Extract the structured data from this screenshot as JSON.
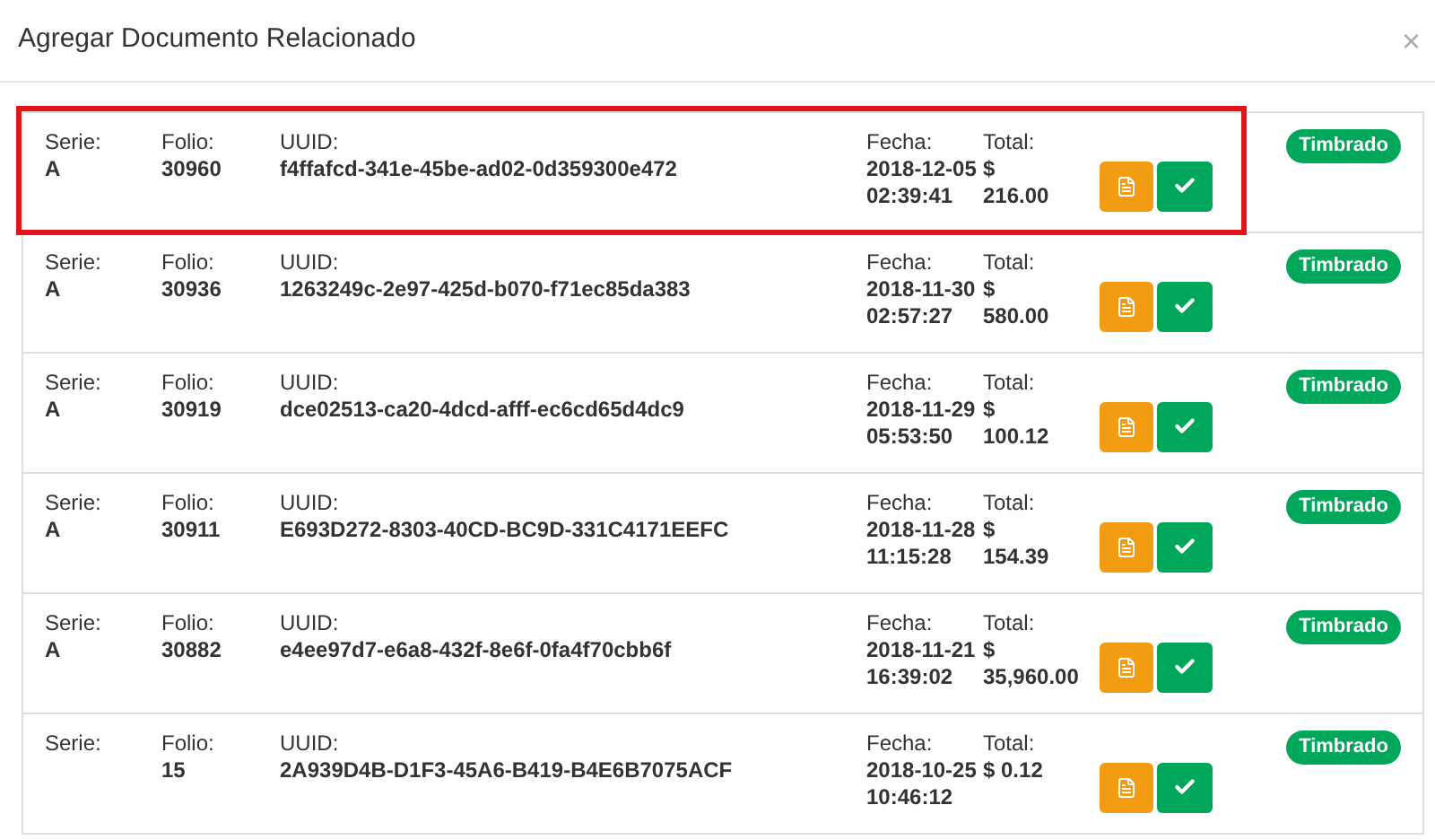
{
  "modal": {
    "title": "Agregar Documento Relacionado",
    "close": "×"
  },
  "rows": [
    {
      "selected": true,
      "fields": [
        {
          "label": "Serie:",
          "value": "A"
        },
        {
          "label": "Folio:",
          "value": "30960"
        },
        {
          "label": "UUID:",
          "value": "f4ffafcd-341e-45be-ad02-0d359300e472"
        },
        {
          "label": "Fecha:",
          "value": "2018-12-05 02:39:41"
        },
        {
          "label": "Total:",
          "value": "$ 216.00"
        }
      ],
      "status": "Timbrado"
    },
    {
      "selected": false,
      "fields": [
        {
          "label": "Serie:",
          "value": "A"
        },
        {
          "label": "Folio:",
          "value": "30936"
        },
        {
          "label": "UUID:",
          "value": "1263249c-2e97-425d-b070-f71ec85da383"
        },
        {
          "label": "Fecha:",
          "value": "2018-11-30 02:57:27"
        },
        {
          "label": "Total:",
          "value": "$ 580.00"
        }
      ],
      "status": "Timbrado"
    },
    {
      "selected": false,
      "fields": [
        {
          "label": "Serie:",
          "value": "A"
        },
        {
          "label": "Folio:",
          "value": "30919"
        },
        {
          "label": "UUID:",
          "value": "dce02513-ca20-4dcd-afff-ec6cd65d4dc9"
        },
        {
          "label": "Fecha:",
          "value": "2018-11-29 05:53:50"
        },
        {
          "label": "Total:",
          "value": "$ 100.12"
        }
      ],
      "status": "Timbrado"
    },
    {
      "selected": false,
      "fields": [
        {
          "label": "Serie:",
          "value": "A"
        },
        {
          "label": "Folio:",
          "value": "30911"
        },
        {
          "label": "UUID:",
          "value": "E693D272-8303-40CD-BC9D-331C4171EEFC"
        },
        {
          "label": "Fecha:",
          "value": "2018-11-28 11:15:28"
        },
        {
          "label": "Total:",
          "value": "$ 154.39"
        }
      ],
      "status": "Timbrado"
    },
    {
      "selected": false,
      "fields": [
        {
          "label": "Serie:",
          "value": "A"
        },
        {
          "label": "Folio:",
          "value": "30882"
        },
        {
          "label": "UUID:",
          "value": "e4ee97d7-e6a8-432f-8e6f-0fa4f70cbb6f"
        },
        {
          "label": "Fecha:",
          "value": "2018-11-21 16:39:02"
        },
        {
          "label": "Total:",
          "value": "$ 35,960.00"
        }
      ],
      "status": "Timbrado"
    },
    {
      "selected": false,
      "fields": [
        {
          "label": "Serie:"
        },
        {
          "label": "Folio:",
          "value": "15"
        },
        {
          "label": "UUID:",
          "value": "2A939D4B-D1F3-45A6-B419-B4E6B7075ACF"
        },
        {
          "label": "Fecha:",
          "value": "2018-10-25 10:46:12"
        },
        {
          "label": "Total:",
          "value": "$ 0.12"
        }
      ],
      "status": "Timbrado"
    }
  ]
}
